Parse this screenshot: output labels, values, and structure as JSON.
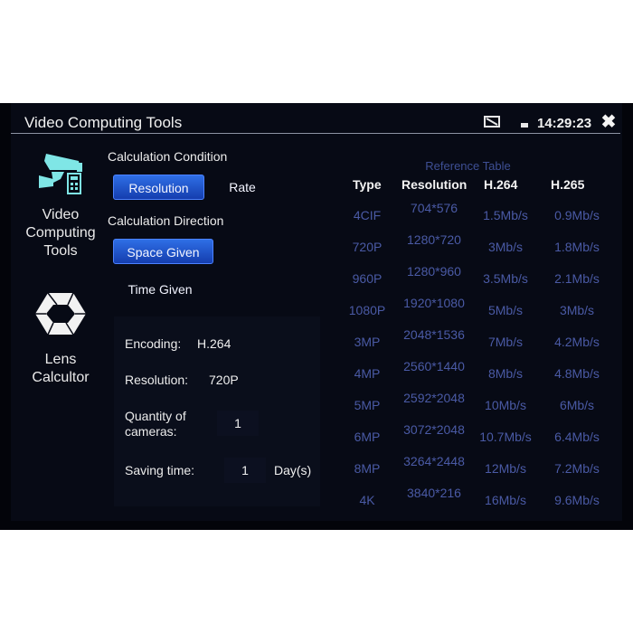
{
  "header": {
    "title": "Video Computing Tools",
    "clock": "14:29:23",
    "icons": [
      "screen-cast-icon",
      "battery-icon",
      "close-icon"
    ]
  },
  "sidebar": {
    "items": [
      {
        "label_lines": [
          "Video",
          "Computing",
          "Tools"
        ],
        "icon": "camera-calculator-icon",
        "selected": true
      },
      {
        "label_lines": [
          "Lens",
          "Calcultor"
        ],
        "icon": "aperture-icon",
        "selected": false
      }
    ]
  },
  "calc": {
    "condition_label": "Calculation Condition",
    "condition_options": [
      {
        "label": "Resolution",
        "active": true
      },
      {
        "label": "Rate",
        "active": false
      }
    ],
    "direction_label": "Calculation Direction",
    "direction_options": [
      {
        "label": "Space Given",
        "active": true
      },
      {
        "label": "Time Given",
        "active": false
      }
    ]
  },
  "form": {
    "encoding_label": "Encoding:",
    "encoding_value": "H.264",
    "resolution_label": "Resolution:",
    "resolution_value": "720P",
    "quantity_label_lines": [
      "Quantity of",
      "cameras:"
    ],
    "quantity_value": "1",
    "saving_label": "Saving time:",
    "saving_value": "1",
    "saving_unit": "Day(s)"
  },
  "reference": {
    "title": "Reference Table",
    "headers": [
      "Type",
      "Resolution",
      "H.264",
      "H.265"
    ],
    "rows": [
      {
        "type": "4CIF",
        "resolution": "704*576",
        "h264": "1.5Mb/s",
        "h265": "0.9Mb/s"
      },
      {
        "type": "720P",
        "resolution": "1280*720",
        "h264": "3Mb/s",
        "h265": "1.8Mb/s"
      },
      {
        "type": "960P",
        "resolution": "1280*960",
        "h264": "3.5Mb/s",
        "h265": "2.1Mb/s"
      },
      {
        "type": "1080P",
        "resolution": "1920*1080",
        "h264": "5Mb/s",
        "h265": "3Mb/s"
      },
      {
        "type": "3MP",
        "resolution": "2048*1536",
        "h264": "7Mb/s",
        "h265": "4.2Mb/s"
      },
      {
        "type": "4MP",
        "resolution": "2560*1440",
        "h264": "8Mb/s",
        "h265": "4.8Mb/s"
      },
      {
        "type": "5MP",
        "resolution": "2592*2048",
        "h264": "10Mb/s",
        "h265": "6Mb/s"
      },
      {
        "type": "6MP",
        "resolution": "3072*2048",
        "h264": "10.7Mb/s",
        "h265": "6.4Mb/s"
      },
      {
        "type": "8MP",
        "resolution": "3264*2448",
        "h264": "12Mb/s",
        "h265": "7.2Mb/s"
      },
      {
        "type": "4K",
        "resolution": "3840*216",
        "h264": "16Mb/s",
        "h265": "9.6Mb/s"
      }
    ]
  },
  "colors": {
    "accent_button": "#1f4fc8",
    "table_text": "#4a5aa5",
    "icon_cyan": "#7fe6e6"
  }
}
